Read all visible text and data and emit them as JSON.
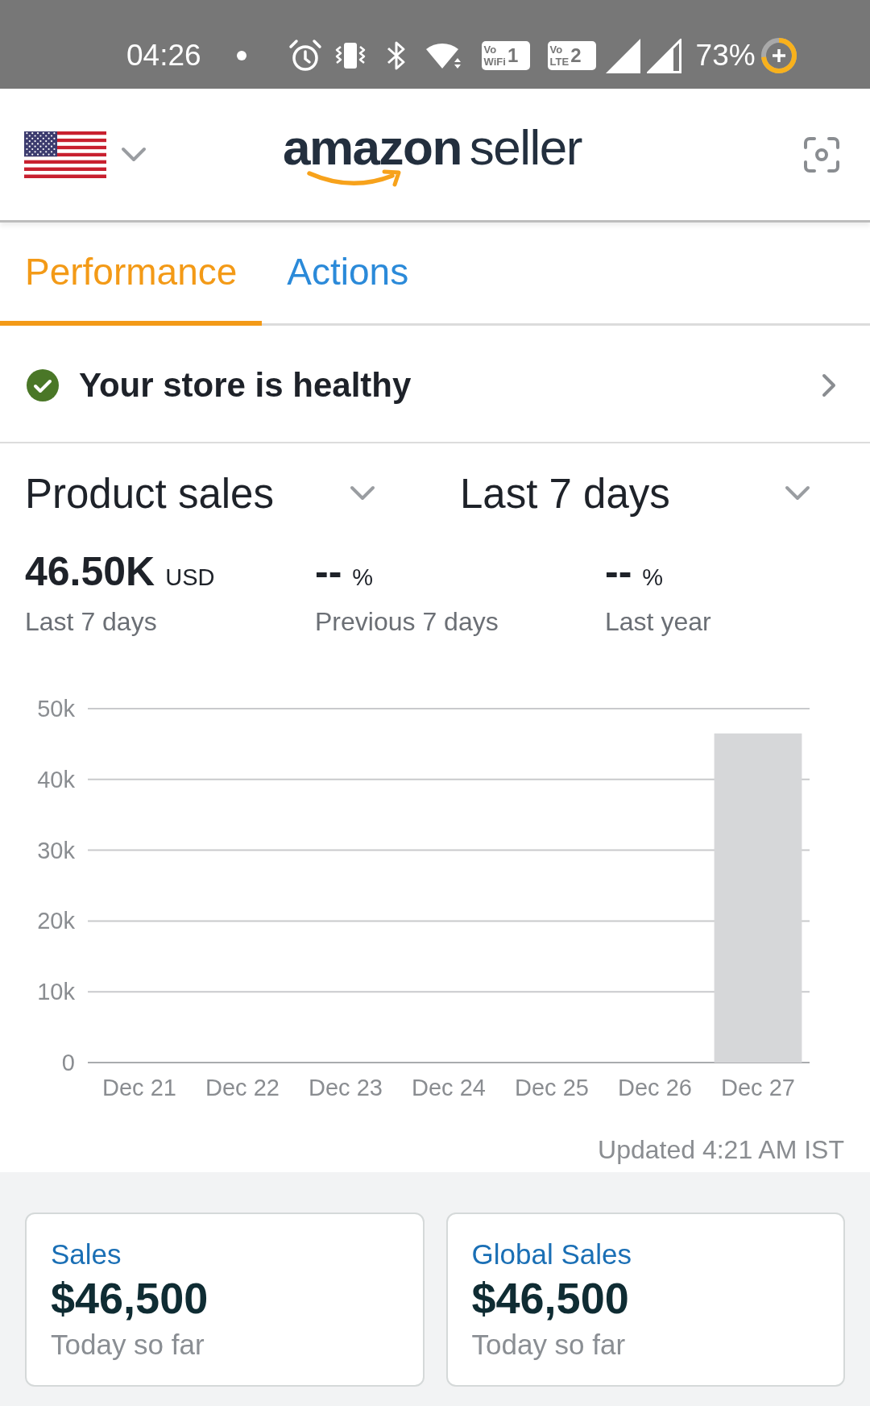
{
  "status_bar": {
    "time": "04:26",
    "badges": [
      {
        "top": "Vo",
        "bottom": "WiFi",
        "index": "1"
      },
      {
        "top": "Vo",
        "bottom": "LTE",
        "index": "2"
      }
    ],
    "battery": "73%"
  },
  "header": {
    "logo": {
      "brand": "amazon",
      "product": "seller"
    }
  },
  "tabs": [
    {
      "label": "Performance",
      "selected": true
    },
    {
      "label": "Actions",
      "selected": false
    }
  ],
  "health": {
    "text": "Your store is healthy"
  },
  "filters": [
    {
      "label": "Product sales"
    },
    {
      "label": "Last 7 days"
    }
  ],
  "stats": [
    {
      "value": "46.50K",
      "unit": "USD",
      "caption": "Last 7 days"
    },
    {
      "value": "--",
      "unit": "%",
      "caption": "Previous 7 days"
    },
    {
      "value": "--",
      "unit": "%",
      "caption": "Last year"
    }
  ],
  "chart": {
    "chart_data": {
      "type": "bar",
      "categories": [
        "Dec 21",
        "Dec 22",
        "Dec 23",
        "Dec 24",
        "Dec 25",
        "Dec 26",
        "Dec 27"
      ],
      "values": [
        0,
        0,
        0,
        0,
        0,
        0,
        46500
      ],
      "ylim": [
        0,
        50000
      ],
      "yticks": [
        {
          "value": 0,
          "label": "0"
        },
        {
          "value": 10000,
          "label": "10k"
        },
        {
          "value": 20000,
          "label": "20k"
        },
        {
          "value": 30000,
          "label": "30k"
        },
        {
          "value": 40000,
          "label": "40k"
        },
        {
          "value": 50000,
          "label": "50k"
        }
      ],
      "grid": true
    },
    "updated": "Updated 4:21 AM IST"
  },
  "cards": [
    {
      "title": "Sales",
      "amount": "$46,500",
      "caption": "Today so far"
    },
    {
      "title": "Global Sales",
      "amount": "$46,500",
      "caption": "Today so far"
    }
  ]
}
